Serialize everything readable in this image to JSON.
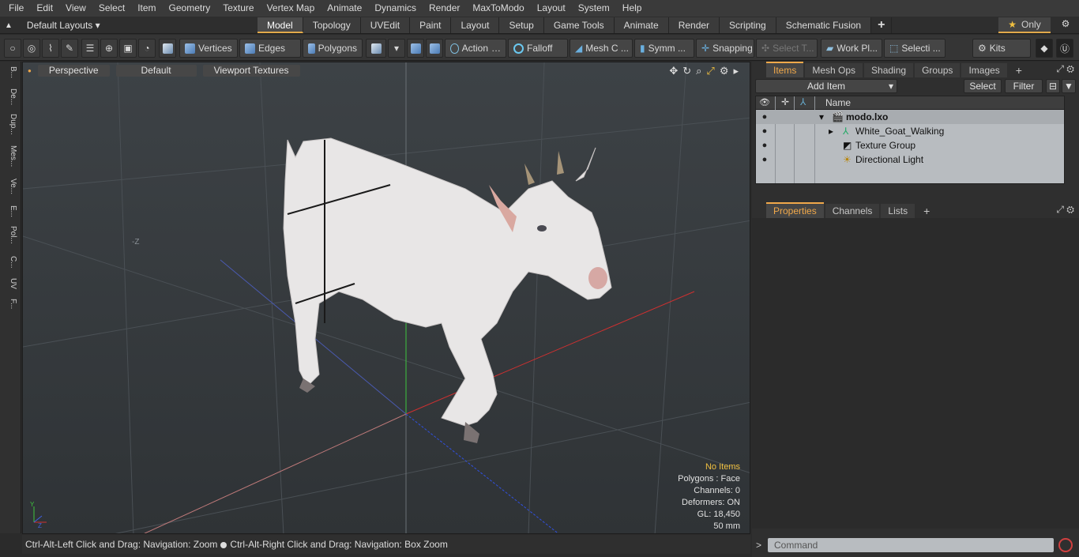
{
  "menu": [
    "File",
    "Edit",
    "View",
    "Select",
    "Item",
    "Geometry",
    "Texture",
    "Vertex Map",
    "Animate",
    "Dynamics",
    "Render",
    "MaxToModo",
    "Layout",
    "System",
    "Help"
  ],
  "layout": {
    "selector": "Default Layouts ▾",
    "only": "Only"
  },
  "tabs": [
    "Model",
    "Topology",
    "UVEdit",
    "Paint",
    "Layout",
    "Setup",
    "Game Tools",
    "Animate",
    "Render",
    "Scripting",
    "Schematic Fusion",
    "+"
  ],
  "active_tab": "Model",
  "toolbar": {
    "vertices": "Vertices",
    "edges": "Edges",
    "polygons": "Polygons",
    "action": "Action",
    "falloff": "Falloff",
    "mesh": "Mesh C ...",
    "symm": "Symm ...",
    "snapping": "Snapping",
    "select_t": "Select T...",
    "workpl": "Work Pl...",
    "selecti": "Selecti ...",
    "kits": "Kits"
  },
  "left_tabs": [
    "B...",
    "De...",
    "Dup...",
    "Mes...",
    "Ve...",
    "E...",
    "Pol...",
    "C...",
    "UV",
    "F..."
  ],
  "viewport": {
    "perspective": "Perspective",
    "default": "Default",
    "textures": "Viewport Textures",
    "axis_label": "-Z",
    "info": {
      "no_items": "No Items",
      "polygons": "Polygons : Face",
      "channels": "Channels: 0",
      "deformers": "Deformers: ON",
      "gl": "GL: 18,450",
      "mm": "50 mm"
    }
  },
  "status": {
    "left": "Ctrl-Alt-Left Click and Drag: Navigation: Zoom",
    "right": "Ctrl-Alt-Right Click and Drag: Navigation: Box Zoom"
  },
  "items_panel": {
    "tabs": [
      "Items",
      "Mesh Ops",
      "Shading",
      "Groups",
      "Images",
      "+"
    ],
    "add_item": "Add Item",
    "select": "Select",
    "filter": "Filter",
    "name_col": "Name",
    "rows": [
      "modo.lxo",
      "White_Goat_Walking",
      "Texture Group",
      "Directional Light"
    ]
  },
  "props_panel": {
    "tabs": [
      "Properties",
      "Channels",
      "Lists",
      "+"
    ]
  },
  "command": {
    "placeholder": "Command",
    "prompt": ">"
  }
}
